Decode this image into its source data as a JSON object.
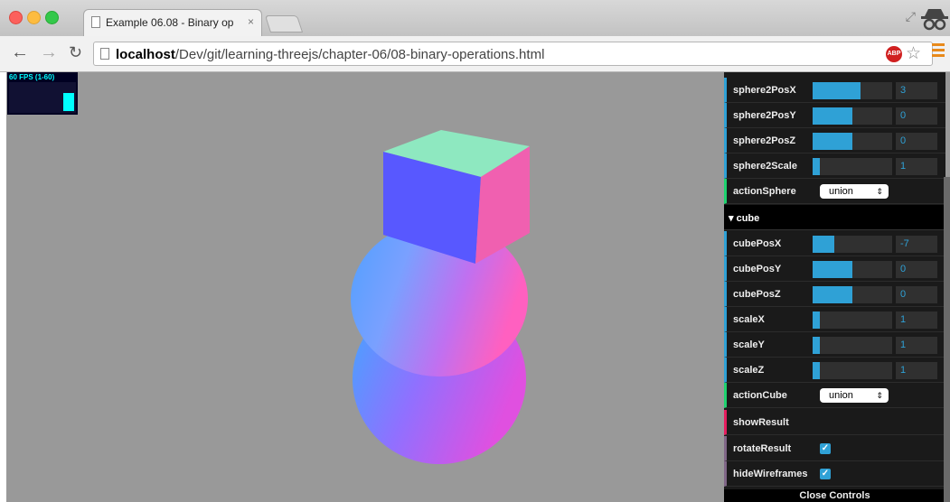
{
  "browser": {
    "tab_title": "Example 06.08 - Binary op",
    "tab_close": "×",
    "url_host": "localhost",
    "url_path": "/Dev/git/learning-threejs/chapter-06/08-binary-operations.html",
    "abp_label": "ABP"
  },
  "stats": {
    "fps_label": "60 FPS (1-60)"
  },
  "gui": {
    "rows": [
      {
        "label": "sphere2PosX",
        "value": "3",
        "fill": 0.6
      },
      {
        "label": "sphere2PosY",
        "value": "0",
        "fill": 0.5
      },
      {
        "label": "sphere2PosZ",
        "value": "0",
        "fill": 0.5
      },
      {
        "label": "sphere2Scale",
        "value": "1",
        "fill": 0.09
      }
    ],
    "actionSphere": {
      "label": "actionSphere",
      "value": "union"
    },
    "cube_folder": "cube",
    "cube_rows": [
      {
        "label": "cubePosX",
        "value": "-7",
        "fill": 0.27
      },
      {
        "label": "cubePosY",
        "value": "0",
        "fill": 0.5
      },
      {
        "label": "cubePosZ",
        "value": "0",
        "fill": 0.5
      },
      {
        "label": "scaleX",
        "value": "1",
        "fill": 0.09
      },
      {
        "label": "scaleY",
        "value": "1",
        "fill": 0.09
      },
      {
        "label": "scaleZ",
        "value": "1",
        "fill": 0.09
      }
    ],
    "actionCube": {
      "label": "actionCube",
      "value": "union"
    },
    "showResult": "showResult",
    "rotateResult": {
      "label": "rotateResult",
      "checked": true
    },
    "hideWireframes": {
      "label": "hideWireframes",
      "checked": true
    },
    "close_controls": "Close Controls"
  },
  "colors": {
    "number": "#2fa1d6",
    "option": "#1ed36f",
    "boolean": "#806787",
    "function": "#e61d5f"
  },
  "icons": {
    "back": "arrow-left-icon",
    "forward": "arrow-right-icon",
    "reload": "reload-icon",
    "star": "star-icon",
    "menu": "hamburger-menu-icon"
  }
}
